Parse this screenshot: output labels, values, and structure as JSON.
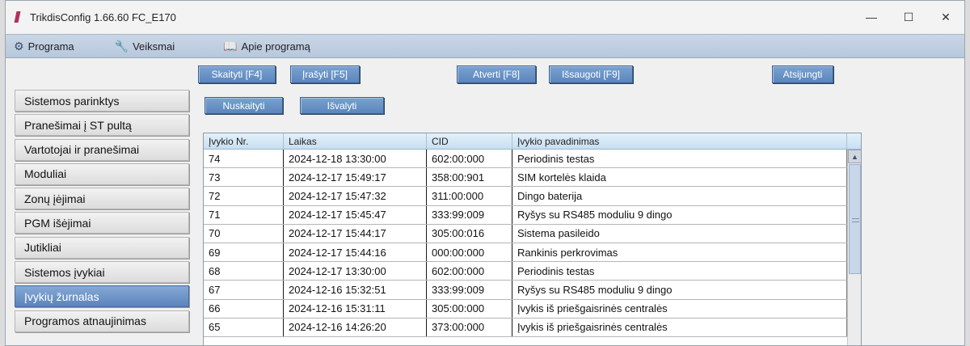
{
  "window": {
    "title": "TrikdisConfig 1.66.60    FC_E170",
    "controls": {
      "minimize": "—",
      "maximize": "☐",
      "close": "✕"
    }
  },
  "menu": [
    {
      "label": "Programa",
      "icon": "gear-icon"
    },
    {
      "label": "Veiksmai",
      "icon": "wrench-icon"
    },
    {
      "label": "Apie programą",
      "icon": "book-icon"
    }
  ],
  "toolbar": {
    "read": "Skaityti [F4]",
    "write": "Įrašyti [F5]",
    "open": "Atverti [F8]",
    "save": "Išsaugoti [F9]",
    "disconnect": "Atsijungti"
  },
  "log_actions": {
    "read_log": "Nuskaityti",
    "clear": "Išvalyti"
  },
  "sidebar": {
    "items": [
      {
        "label": "Sistemos parinktys"
      },
      {
        "label": "Pranešimai į ST pultą"
      },
      {
        "label": "Vartotojai ir pranešimai"
      },
      {
        "label": "Moduliai"
      },
      {
        "label": "Zonų įėjimai"
      },
      {
        "label": "PGM išėjimai"
      },
      {
        "label": "Jutikliai"
      },
      {
        "label": "Sistemos įvykiai"
      },
      {
        "label": "Įvykių žurnalas"
      },
      {
        "label": "Programos atnaujinimas"
      }
    ],
    "active_index": 8
  },
  "event_log": {
    "columns": [
      "Įvykio Nr.",
      "Laikas",
      "CID",
      "Įvykio pavadinimas"
    ],
    "rows": [
      [
        "74",
        "2024-12-18 13:30:00",
        "602:00:000",
        "Periodinis testas"
      ],
      [
        "73",
        "2024-12-17 15:49:17",
        "358:00:901",
        "SIM kortelės klaida"
      ],
      [
        "72",
        "2024-12-17 15:47:32",
        "311:00:000",
        "Dingo baterija"
      ],
      [
        "71",
        "2024-12-17 15:45:47",
        "333:99:009",
        "Ryšys su RS485 moduliu 9 dingo"
      ],
      [
        "70",
        "2024-12-17 15:44:17",
        "305:00:016",
        "Sistema pasileido"
      ],
      [
        "69",
        "2024-12-17 15:44:16",
        "000:00:000",
        "Rankinis perkrovimas"
      ],
      [
        "68",
        "2024-12-17 13:30:00",
        "602:00:000",
        "Periodinis testas"
      ],
      [
        "67",
        "2024-12-16 15:32:51",
        "333:99:009",
        "Ryšys su RS485 moduliu 9 dingo"
      ],
      [
        "66",
        "2024-12-16 15:31:11",
        "305:00:000",
        "Įvykis iš priešgaisrinės centralės"
      ],
      [
        "65",
        "2024-12-16 14:26:20",
        "373:00:000",
        "Įvykis iš priešgaisrinės centralės"
      ]
    ]
  },
  "colors": {
    "accent_button": "#5b86bd",
    "active_nav": "#6f95c8",
    "table_header": "#d4e6f5"
  }
}
